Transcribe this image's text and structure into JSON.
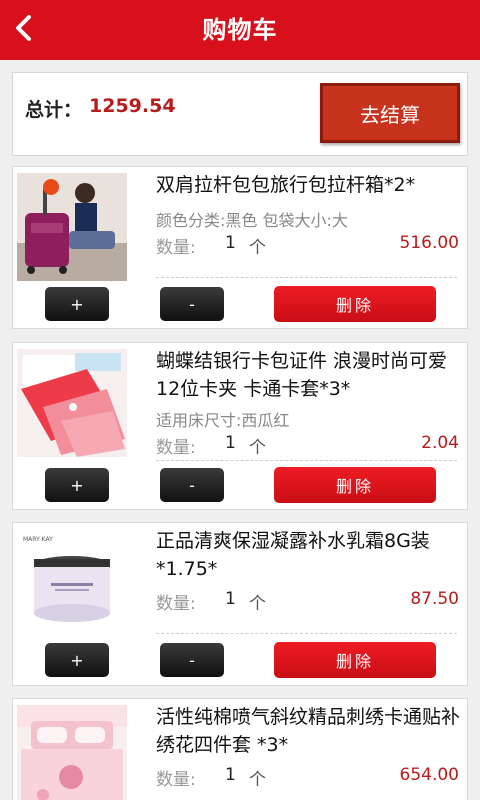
{
  "header": {
    "title": "购物车",
    "back_icon": "chevron-left-icon"
  },
  "summary": {
    "total_label": "总计：",
    "total_value": "1259.54",
    "checkout_label": "去结算"
  },
  "labels": {
    "qty_label": "数量:",
    "unit": "个",
    "plus": "+",
    "minus": "-",
    "delete": "删除"
  },
  "items": [
    {
      "name": "双肩拉杆包包旅行包拉杆箱*2*",
      "spec": "颜色分类:黑色 包袋大小:大",
      "quantity": "1",
      "price": "516.00"
    },
    {
      "name": "蝴蝶结银行卡包证件 浪漫时尚可爱12位卡夹 卡通卡套*3*",
      "spec": "适用床尺寸:西瓜红",
      "quantity": "1",
      "price": "2.04"
    },
    {
      "name": "正品清爽保湿凝露补水乳霜8G装*1.75*",
      "spec": "",
      "quantity": "1",
      "price": "87.50"
    },
    {
      "name": "活性纯棉喷气斜纹精品刺绣卡通贴补绣花四件套 *3*",
      "spec": "",
      "quantity": "1",
      "price": "654.00"
    }
  ],
  "colors": {
    "brand_red": "#d7101c",
    "price_red": "#b71c1c",
    "checkout": "#c7331d"
  }
}
